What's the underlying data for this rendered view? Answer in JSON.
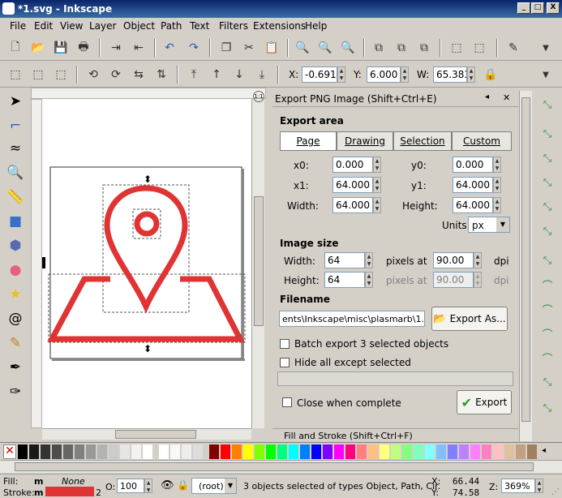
{
  "window": {
    "title": "*1.svg - Inkscape",
    "btn_min": "_",
    "btn_max": "□",
    "btn_close": "X"
  },
  "menu": [
    "File",
    "Edit",
    "View",
    "Layer",
    "Object",
    "Path",
    "Text",
    "Filters",
    "Extensions",
    "Help"
  ],
  "toolbar2": {
    "x_label": "X:",
    "x_value": "-0.691",
    "y_label": "Y:",
    "y_value": "6.000",
    "w_label": "W:",
    "w_value": "65.383"
  },
  "dialog": {
    "title": "Export PNG Image (Shift+Ctrl+E)",
    "export_area_label": "Export area",
    "tabs": [
      "Page",
      "Drawing",
      "Selection",
      "Custom"
    ],
    "x0_label": "x0:",
    "x0_value": "0.000",
    "y0_label": "y0:",
    "y0_value": "0.000",
    "x1_label": "x1:",
    "x1_value": "64.000",
    "y1_label": "y1:",
    "y1_value": "64.000",
    "width_label": "Width:",
    "width_value": "64.000",
    "height_label": "Height:",
    "height_value": "64.000",
    "units_label": "Units:",
    "units_value": "px",
    "image_size_label": "Image size",
    "img_width_label": "Width:",
    "img_width_value": "64",
    "img_height_label": "Height:",
    "img_height_value": "64",
    "pixels_at_1": "pixels at",
    "pixels_at_2": "pixels at",
    "dpi_1_value": "90.00",
    "dpi_2_value": "90.00",
    "dpi_1": "dpi",
    "dpi_2": "dpi",
    "filename_label": "Filename",
    "filename_value": "ents\\Inkscape\\misc\\plasmarb\\1.png",
    "export_as": "Export As...",
    "batch_export": "Batch export 3 selected objects",
    "hide_all": "Hide all except selected",
    "close_when_complete": "Close when complete",
    "export_button": "Export"
  },
  "fill_stroke_title": "Fill and Stroke (Shift+Ctrl+F)",
  "status": {
    "fill_label": "Fill:",
    "fill_value": "m",
    "fill_none": "None",
    "stroke_label": "Stroke:",
    "stroke_value": "m",
    "stroke_width": "2",
    "opacity_label": "O:",
    "opacity_value": "100",
    "layer_value": "(root)",
    "message": "3 objects selected of types Object, Path, Cir.",
    "x_label": "X:",
    "x_value": "66.44",
    "y_label": "Y:",
    "y_value": "74.58",
    "zoom_label": "Z:",
    "zoom_value": "369%"
  },
  "colors": {
    "accent_red": "#e03434",
    "title_blue": "#0a246a"
  }
}
